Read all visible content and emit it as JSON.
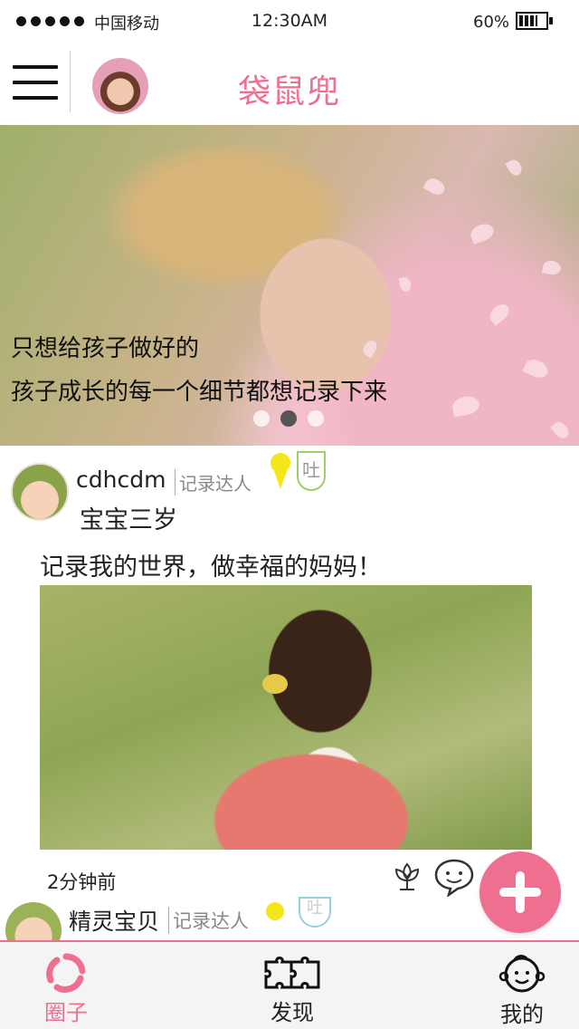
{
  "status_bar": {
    "carrier": "中国移动",
    "time": "12:30AM",
    "battery": "60%"
  },
  "header": {
    "title": "袋鼠兜"
  },
  "banner": {
    "line1": "只想给孩子做好的",
    "line2": "孩子成长的每一个细节都想记录下来",
    "pages": 3,
    "active_page": 2
  },
  "post": {
    "username": "cdhcdm",
    "tag": "记录达人",
    "badge_text": "吐",
    "baby_age": "宝宝三岁",
    "text": "记录我的世界，做幸福的妈妈！",
    "time": "2分钟前"
  },
  "post2": {
    "username": "精灵宝贝",
    "tag": "记录达人",
    "badge_text": "吐"
  },
  "tabbar": {
    "tabs": [
      {
        "label": "圈子",
        "icon": "circle-icon",
        "active": true
      },
      {
        "label": "发现",
        "icon": "puzzle-icon",
        "active": false
      },
      {
        "label": "我的",
        "icon": "baby-face-icon",
        "active": false
      }
    ]
  },
  "colors": {
    "accent": "#ee6f8f",
    "badge_yellow": "#f5e61a",
    "badge_green": "#9fce6b"
  }
}
